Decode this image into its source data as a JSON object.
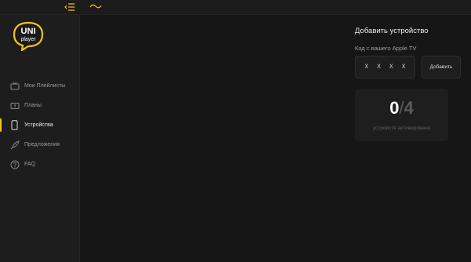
{
  "app": {
    "logo_line1": "UNI",
    "logo_line2": "player"
  },
  "sidebar": {
    "items": [
      {
        "label": "Мои Плейлисты",
        "icon": "tv-icon",
        "active": false
      },
      {
        "label": "Планы",
        "icon": "ticket-icon",
        "active": false
      },
      {
        "label": "Устройства",
        "icon": "phone-icon",
        "active": true
      },
      {
        "label": "Предложения",
        "icon": "rocket-icon",
        "active": false
      },
      {
        "label": "FAQ",
        "icon": "question-icon",
        "active": false
      }
    ]
  },
  "panel": {
    "title": "Добавить устройство",
    "code_label": "Код с вашего Apple TV",
    "code_chars": [
      "X",
      "X",
      "X",
      "X"
    ],
    "add_button": "Добавить",
    "counter": {
      "current": "0",
      "separator": "/",
      "max": "4",
      "caption": "устройств активировано"
    }
  },
  "colors": {
    "accent": "#f4c21a",
    "background": "#161616",
    "sidebar": "#1d1d1d"
  }
}
